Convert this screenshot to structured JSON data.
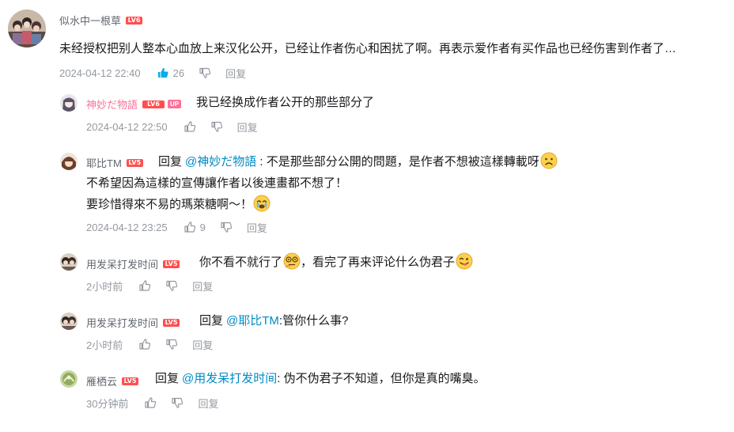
{
  "main_comment": {
    "username": "似水中一根草",
    "level": "LV6",
    "text": "未经授权把别人整本心血放上来汉化公开，已经让作者伤心和困扰了啊。再表示爱作者有买作品也已经伤害到作者了…",
    "time": "2024-04-12 22:40",
    "likes": "26",
    "reply_label": "回复",
    "like_color": "#00aeec"
  },
  "replies": [
    {
      "username": "神妙だ物語",
      "level": "LV6",
      "up_badge": "UP",
      "text": "我已经换成作者公开的那些部分了",
      "time": "2024-04-12 22:50",
      "likes": "",
      "reply_label": "回复"
    },
    {
      "username": "耶比TM",
      "level": "LV5",
      "reply_word": "回复",
      "reply_to": "@神妙だ物語",
      "line1": "不是那些部分公開的問題，是作者不想被這樣轉載呀",
      "line2": "不希望因為這樣的宣傳讓作者以後連畫都不想了！",
      "line3": "要珍惜得來不易的瑪萊糖啊～！",
      "time": "2024-04-12 23:25",
      "likes": "9",
      "reply_label": "回复"
    },
    {
      "username": "用发呆打发时间",
      "level": "LV5",
      "text_a": "你不看不就行了",
      "text_b": "，看完了再来评论什么伪君子",
      "time": "2小时前",
      "reply_label": "回复"
    },
    {
      "username": "用发呆打发时间",
      "level": "LV5",
      "reply_word": "回复",
      "reply_to": "@耶比TM",
      "text": ":管你什么事?",
      "time": "2小时前",
      "reply_label": "回复"
    },
    {
      "username": "雁栖云",
      "level": "LV5",
      "reply_word": "回复",
      "reply_to": "@用发呆打发时间",
      "text": ": 伪不伪君子不知道，但你是真的嘴臭。",
      "time": "30分钟前",
      "reply_label": "回复"
    }
  ],
  "colors": {
    "link": "#008ac5",
    "meta": "#9499a0",
    "level": "#ff4f4f",
    "up": "#fb7299"
  },
  "icons": [
    "thumbs-up-icon",
    "thumbs-down-icon",
    "sad-emoji",
    "crying-emoji",
    "doubt-emoji",
    "tongue-emoji"
  ]
}
